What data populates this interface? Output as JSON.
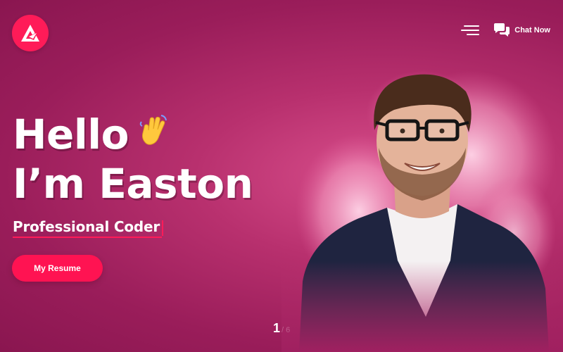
{
  "header": {
    "menu_icon": "hamburger-menu-icon",
    "chat_icon": "chat-bubbles-icon",
    "chat_label": "Chat Now",
    "logo_icon": "a-logo-icon"
  },
  "hero": {
    "greeting": "Hello",
    "name_line": "I’m Easton",
    "wave_icon": "waving-hand-icon",
    "subtitle": "Professional Coder",
    "cta_label": "My Resume"
  },
  "slider": {
    "current": "1",
    "total": "/ 6"
  },
  "colors": {
    "accent": "#ff1b58",
    "background": "#b8306e"
  }
}
